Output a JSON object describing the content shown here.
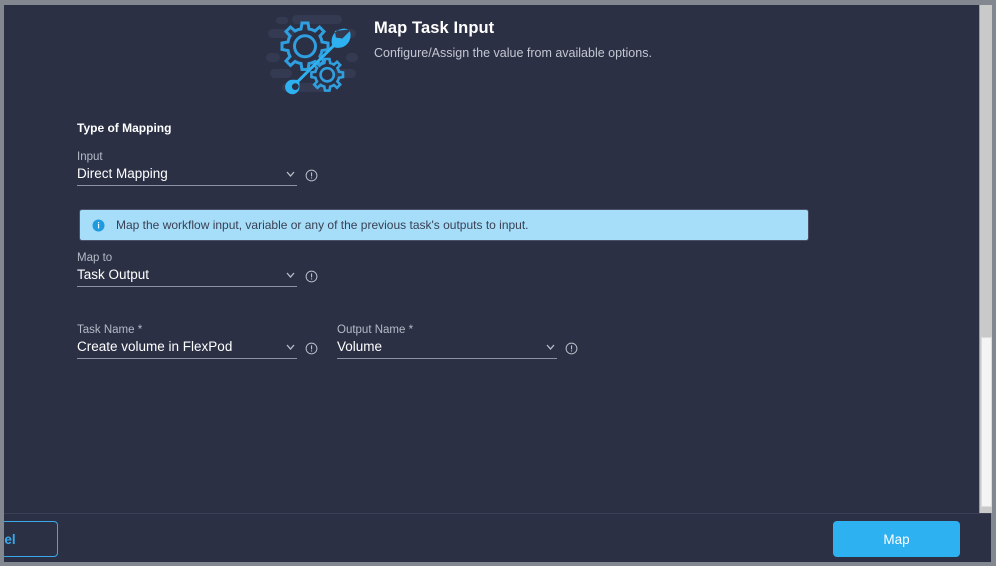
{
  "window": {
    "scrollbar_present": true
  },
  "header": {
    "icon": "gear-wrench-icon",
    "title": "Map Task Input",
    "subtitle": "Configure/Assign the value from available options."
  },
  "form": {
    "section_title": "Type of Mapping",
    "fields": [
      {
        "key": "input",
        "label": "Input",
        "value": "Direct Mapping",
        "required": false,
        "chevron_icon": "chevron-down-icon",
        "info_icon": "info-circle-icon"
      },
      {
        "key": "map_to",
        "label": "Map to",
        "value": "Task Output",
        "required": false,
        "chevron_icon": "chevron-down-icon",
        "info_icon": "info-circle-icon"
      },
      {
        "key": "task_name",
        "label": "Task Name *",
        "value": "Create volume in FlexPod",
        "required": true,
        "chevron_icon": "chevron-down-icon",
        "info_icon": "info-circle-icon"
      },
      {
        "key": "output_name",
        "label": "Output Name *",
        "value": "Volume",
        "required": true,
        "chevron_icon": "chevron-down-icon",
        "info_icon": "info-circle-icon"
      }
    ]
  },
  "banner": {
    "icon": "info-circle-filled-icon",
    "text": "Map the workflow input, variable or any of the previous task's outputs to input.",
    "background_color": "#a6ddf8"
  },
  "footer": {
    "cancel_label": "el",
    "map_label": "Map"
  },
  "colors": {
    "page_background": "#2b3045",
    "accent_blue": "#2eb1f0",
    "link_blue": "#3ba9e8",
    "text_primary": "#ffffff",
    "text_secondary": "#b5bac6",
    "underline": "#8d93a3"
  }
}
